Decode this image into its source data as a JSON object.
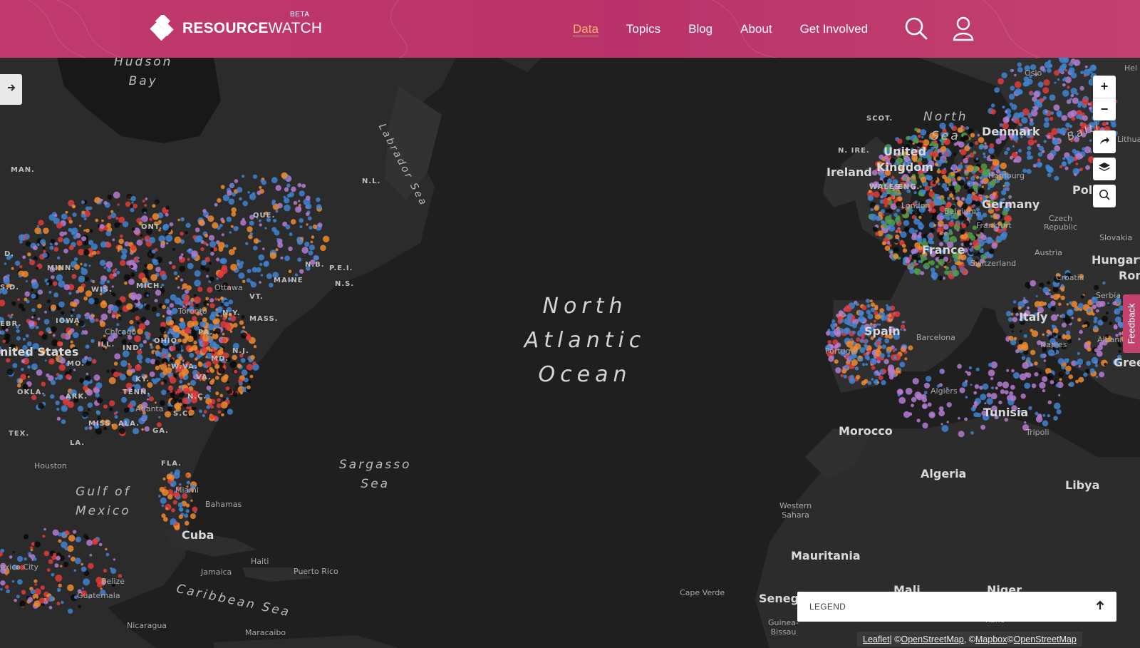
{
  "header": {
    "logo_bold": "RESOURCE",
    "logo_rest": "WATCH",
    "beta": "BETA",
    "nav": [
      "Data",
      "Topics",
      "Blog",
      "About",
      "Get Involved"
    ],
    "active_nav": "Data",
    "accent_color": "#f6b26b",
    "bar_color": "#bd386b"
  },
  "map": {
    "ocean": [
      "North",
      "Atlantic",
      "Ocean"
    ],
    "water_labels": {
      "hudson": [
        "Hudson",
        "Bay"
      ],
      "labrador": "Labrador Sea",
      "north_sea": [
        "North",
        "Sea"
      ],
      "sargasso": [
        "Sargasso",
        "Sea"
      ],
      "gulf": [
        "Gulf of",
        "Mexico"
      ],
      "caribbean": "Caribbean Sea",
      "baltic": "Balti"
    },
    "countries": {
      "us": "nited States",
      "cuba": "Cuba",
      "ireland": "Ireland",
      "uk": "United Kingdom",
      "denmark": "Denmark",
      "germany": "Germany",
      "france": "France",
      "spain": "Spain",
      "italy": "Italy",
      "hungary": "Hungary",
      "morocco": "Morocco",
      "algeria": "Algeria",
      "tunisia": "Tunisia",
      "libya": "Libya",
      "mauritania": "Mauritania",
      "mali": "Mali",
      "niger": "Niger",
      "senegal": "Seneg",
      "poland": "Pol",
      "romania": "Ron",
      "greece": "Gree"
    },
    "states": {
      "man": "MAN.",
      "ont": "ONT.",
      "que": "QUE.",
      "nl": "N.L.",
      "minn": "MINN.",
      "wis": "WIS.",
      "mich": "MICH.",
      "iowa": "IOWA",
      "ill": "ILL.",
      "ind": "IND.",
      "ohio": "OHIO",
      "pa": "PA.",
      "ny": "N.Y.",
      "vt": "VT.",
      "mass": "MASS.",
      "maine": "MAINE",
      "nb": "N.B.",
      "pei": "P.E.I.",
      "ns": "N.S.",
      "nj": "N.J.",
      "md": "MD.",
      "wva": "W.VA.",
      "va": "VA.",
      "ky": "KY.",
      "tenn": "TENN.",
      "nc": "N.C.",
      "sc": "S.C.",
      "ga": "GA.",
      "ala": "ALA.",
      "miss": "MISS.",
      "ark": "ARK.",
      "mo": "MO.",
      "okla": "OKLA.",
      "tex": "TEX.",
      "la": "LA.",
      "fla": "FLA.",
      "ebr": "EBR.",
      "sd": "S.D.",
      "nd": "D.",
      "scot": "SCOT.",
      "nire": "N. IRE.",
      "wales": "WALES",
      "eng": "ENG."
    },
    "cities": {
      "ottawa": "Ottawa",
      "toronto": "Toronto",
      "chicago": "Chicago",
      "atlanta": "Atlanta",
      "houston": "Houston",
      "miami": "Miami",
      "bahamas": "Bahamas",
      "haiti": "Haiti",
      "jamaica": "Jamaica",
      "puerto": "Puerto Rico",
      "belize": "Belize",
      "guatemala": "Guatemala",
      "nicaragua": "Nicaragua",
      "mexcity": "exico City",
      "maracaibo": "Maracaibo",
      "capeverde": "Cape Verde",
      "westsahara": [
        "Western",
        "Sahara"
      ],
      "guinea": [
        "Guinea-",
        "Bissau"
      ],
      "oslo": "Oslo",
      "london": "London",
      "belgium": "Belgium",
      "hamburg": "Hamburg",
      "frankfurt": "Frankfurt",
      "czech": [
        "Czech",
        "Republic"
      ],
      "slovakia": "Slovakia",
      "austria": "Austria",
      "switzerland": "Switzerland",
      "croatia": "Croatia",
      "serbia": "Serbia",
      "albania": "Albania",
      "naples": "Naples",
      "barcelona": "Barcelona",
      "portugal": "Portugal",
      "algiers": "Algiers",
      "tripoli": "Tripoli",
      "kano": "Kano",
      "lithuania": "Lithua",
      "helsinki": "Hel"
    }
  },
  "controls": {
    "zoom_in": "+",
    "zoom_out": "−"
  },
  "feedback": "Feedback",
  "legend": {
    "title": "LEGEND"
  },
  "attribution": {
    "leaflet": "Leaflet",
    "sep1": " | © ",
    "osm1": "OpenStreetMap",
    "sep2": ", © ",
    "mapbox": "Mapbox",
    "sep3": " © ",
    "osm2": "OpenStreetMap"
  },
  "colors": {
    "orange": "#f08a2e",
    "blue": "#3f84d2",
    "purple": "#b47bd1",
    "red": "#e03b3b",
    "black": "#0b0b0b",
    "green": "#4f9d4a"
  }
}
